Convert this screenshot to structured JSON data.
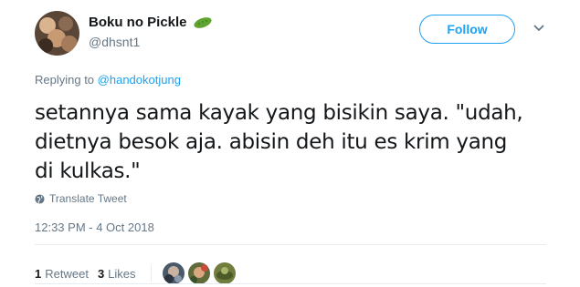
{
  "author": {
    "display_name": "Boku no Pickle",
    "handle": "@dhsnt1",
    "avatar_icon": "profile-photo-cats",
    "badge_icon": "pickle-emoji"
  },
  "actions": {
    "follow_label": "Follow",
    "menu_icon": "chevron-down-icon"
  },
  "reply": {
    "prefix": "Replying to ",
    "mention": "@handokotjung"
  },
  "tweet": {
    "text": "setannya sama kayak yang bisikin saya. \"udah,\ndietnya besok aja. abisin deh itu es krim yang\ndi kulkas.\"",
    "translate_label": "Translate Tweet",
    "timestamp": "12:33 PM - 4 Oct 2018"
  },
  "stats": {
    "retweets_count": "1",
    "retweets_label": "Retweet",
    "likes_count": "3",
    "likes_label": "Likes"
  },
  "colors": {
    "accent": "#1da1f2",
    "secondary_text": "#657786",
    "divider": "#e6ecf0"
  }
}
